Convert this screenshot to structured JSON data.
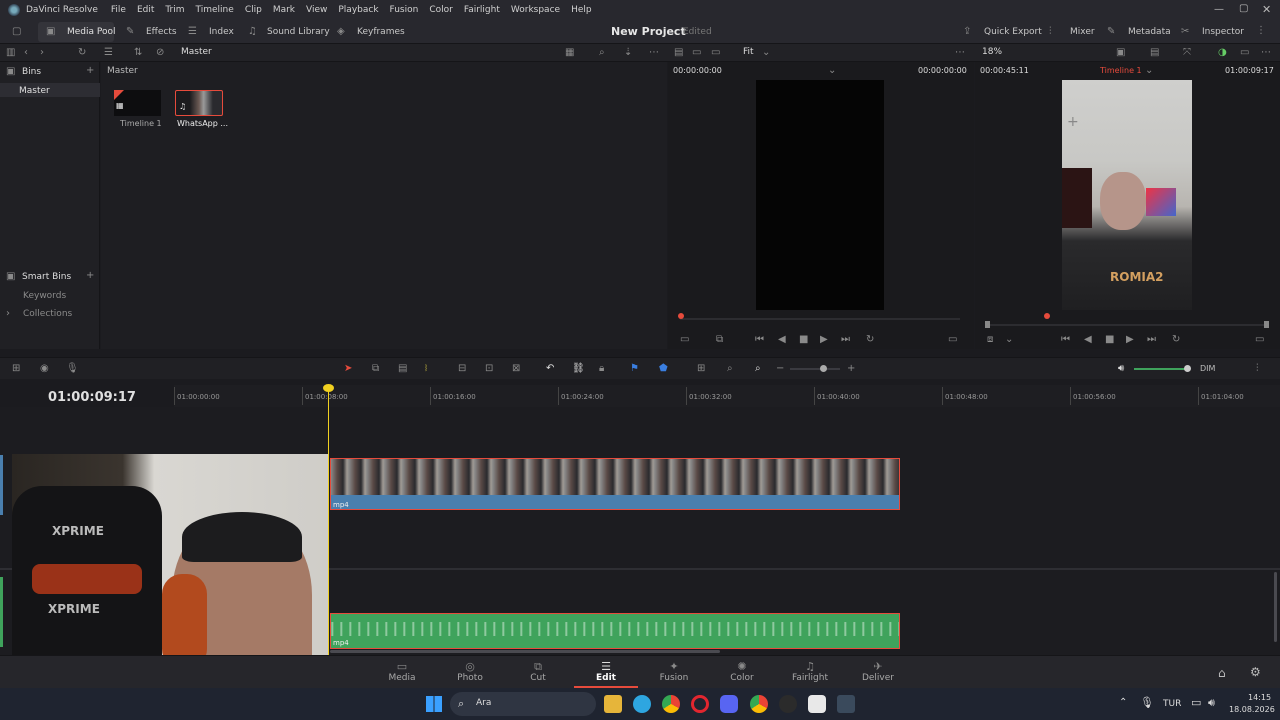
{
  "app": {
    "title": "DaVinci Resolve",
    "menu": [
      "File",
      "Edit",
      "Trim",
      "Timeline",
      "Clip",
      "Mark",
      "View",
      "Playback",
      "Fusion",
      "Color",
      "Fairlight",
      "Workspace",
      "Help"
    ]
  },
  "toolbar": {
    "media_pool": "Media Pool",
    "effects": "Effects",
    "index": "Index",
    "sound_library": "Sound Library",
    "keyframes": "Keyframes",
    "project_title": "New Project",
    "project_status": "Edited",
    "quick_export": "Quick Export",
    "mixer": "Mixer",
    "metadata": "Metadata",
    "inspector": "Inspector"
  },
  "subbar": {
    "bin_path": "Master",
    "fit": "Fit",
    "zoom": "18%"
  },
  "bins": {
    "header": "Bins",
    "items": [
      "Master"
    ],
    "smart_header": "Smart Bins",
    "smart_items": [
      "Keywords",
      "Collections"
    ]
  },
  "pool": {
    "path": "Master",
    "clips": [
      {
        "name": "Timeline 1"
      },
      {
        "name": "WhatsApp ..."
      }
    ]
  },
  "source_viewer": {
    "tc_left": "00:00:00:00",
    "tc_right": "00:00:00:00"
  },
  "timeline_viewer": {
    "duration": "00:00:45:11",
    "timeline_name": "Timeline 1",
    "timecode": "01:00:09:17"
  },
  "timeline": {
    "current_tc": "01:00:09:17",
    "ruler": [
      "01:00:00:00",
      "01:00:08:00",
      "01:00:16:00",
      "01:00:24:00",
      "01:00:32:00",
      "01:00:40:00",
      "01:00:48:00",
      "01:00:56:00",
      "01:01:04:00"
    ],
    "video_clip_label": "mp4",
    "audio_clip_label": "mp4",
    "dim": "DIM"
  },
  "pages": [
    "Media",
    "Photo",
    "Cut",
    "Edit",
    "Fusion",
    "Color",
    "Fairlight",
    "Deliver"
  ],
  "active_page": "Edit",
  "taskbar": {
    "search": "Ara",
    "lang": "TUR",
    "time": "14:15",
    "date": "18.08.2026"
  },
  "colors": {
    "accent": "#e64b3c",
    "audio": "#3fa35c",
    "playhead": "#f0d020",
    "video_track": "#4a7fae"
  }
}
